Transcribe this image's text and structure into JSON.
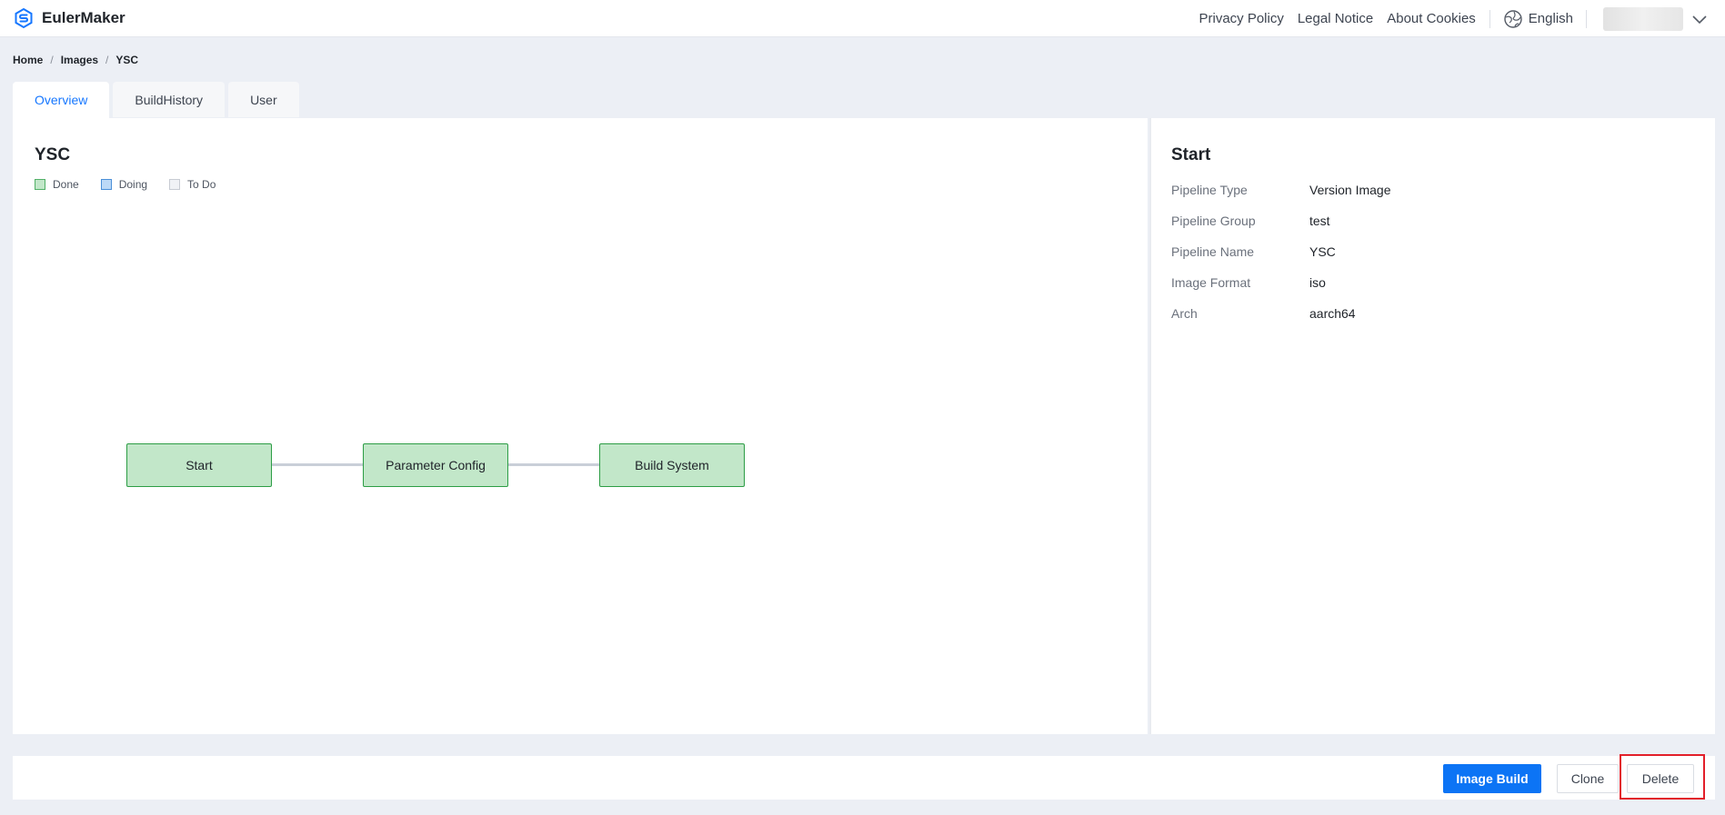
{
  "app": {
    "name": "EulerMaker"
  },
  "topnav": {
    "links": [
      "Privacy Policy",
      "Legal Notice",
      "About Cookies"
    ],
    "language": "English"
  },
  "breadcrumb": [
    "Home",
    "Images",
    "YSC"
  ],
  "tabs": [
    {
      "label": "Overview",
      "active": true
    },
    {
      "label": "BuildHistory",
      "active": false
    },
    {
      "label": "User",
      "active": false
    }
  ],
  "overview": {
    "title": "YSC",
    "legend": [
      {
        "label": "Done",
        "status": "done"
      },
      {
        "label": "Doing",
        "status": "doing"
      },
      {
        "label": "To Do",
        "status": "todo"
      }
    ],
    "pipeline": [
      {
        "label": "Start",
        "status": "done"
      },
      {
        "label": "Parameter Config",
        "status": "done"
      },
      {
        "label": "Build System",
        "status": "done"
      }
    ]
  },
  "details": {
    "title": "Start",
    "rows": [
      {
        "key": "Pipeline Type",
        "value": "Version Image"
      },
      {
        "key": "Pipeline Group",
        "value": "test"
      },
      {
        "key": "Pipeline Name",
        "value": "YSC"
      },
      {
        "key": "Image Format",
        "value": "iso"
      },
      {
        "key": "Arch",
        "value": "aarch64"
      }
    ]
  },
  "actions": {
    "image_build": "Image Build",
    "clone": "Clone",
    "delete": "Delete"
  },
  "colors": {
    "accent": "#0c74f5",
    "done": "#c2e7c9",
    "doing": "#bcd9f7",
    "todo": "#f0f2f6",
    "highlight": "#e21f2a"
  }
}
